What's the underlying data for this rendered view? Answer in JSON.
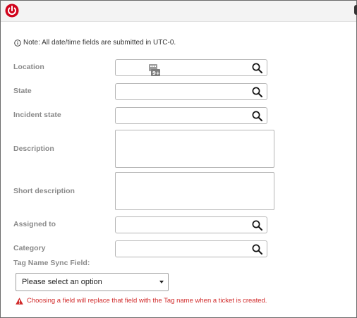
{
  "note": {
    "text": "Note: All date/time fields are submitted in UTC-0."
  },
  "fields": {
    "location": {
      "label": "Location",
      "value": ""
    },
    "state": {
      "label": "State",
      "value": ""
    },
    "incident_state": {
      "label": "Incident state",
      "value": ""
    },
    "description": {
      "label": "Description",
      "value": ""
    },
    "short_description": {
      "label": "Short description",
      "value": ""
    },
    "assigned_to": {
      "label": "Assigned to",
      "value": ""
    },
    "category": {
      "label": "Category",
      "value": ""
    }
  },
  "tag_sync": {
    "label": "Tag Name Sync Field:",
    "selected": "Please select an option",
    "warning": "Choosing a field will replace that field with the Tag name when a ticket is created."
  },
  "colors": {
    "brand": "#d0021b",
    "label": "#8a8a8a",
    "warning": "#d12a2a"
  },
  "icons": [
    "power-icon",
    "info-icon",
    "search-icon",
    "keyboard-badge-icon",
    "chevron-down-icon",
    "warning-icon"
  ]
}
